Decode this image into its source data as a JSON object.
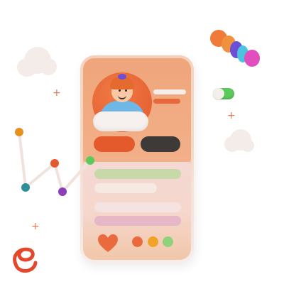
{
  "illustration": {
    "subject": "profile",
    "colors": {
      "background": "#ffffff",
      "accent_orange": "#e45a2c",
      "dark_button": "#3d3a38",
      "green_bar": "#c7d9a9",
      "lavender_bar": "#e6b7c7",
      "pale_bar": "#f6e8e2",
      "chart_line": "#f0e2dc",
      "toggle_green": "#5cc95d"
    },
    "icons": [
      "avatar-icon",
      "heart-icon",
      "cloud-icon",
      "toggle-icon",
      "spring-icon",
      "swirl-icon",
      "plus-icon"
    ],
    "chart_points": [
      {
        "color": "#e6901e"
      },
      {
        "color": "#2e8f9a"
      },
      {
        "color": "#e45a2c"
      },
      {
        "color": "#8a3fb8"
      },
      {
        "color": "#5cc95d"
      }
    ],
    "dots": [
      {
        "color": "#ea6a3e"
      },
      {
        "color": "#f2a227"
      },
      {
        "color": "#8fd27a"
      }
    ]
  }
}
